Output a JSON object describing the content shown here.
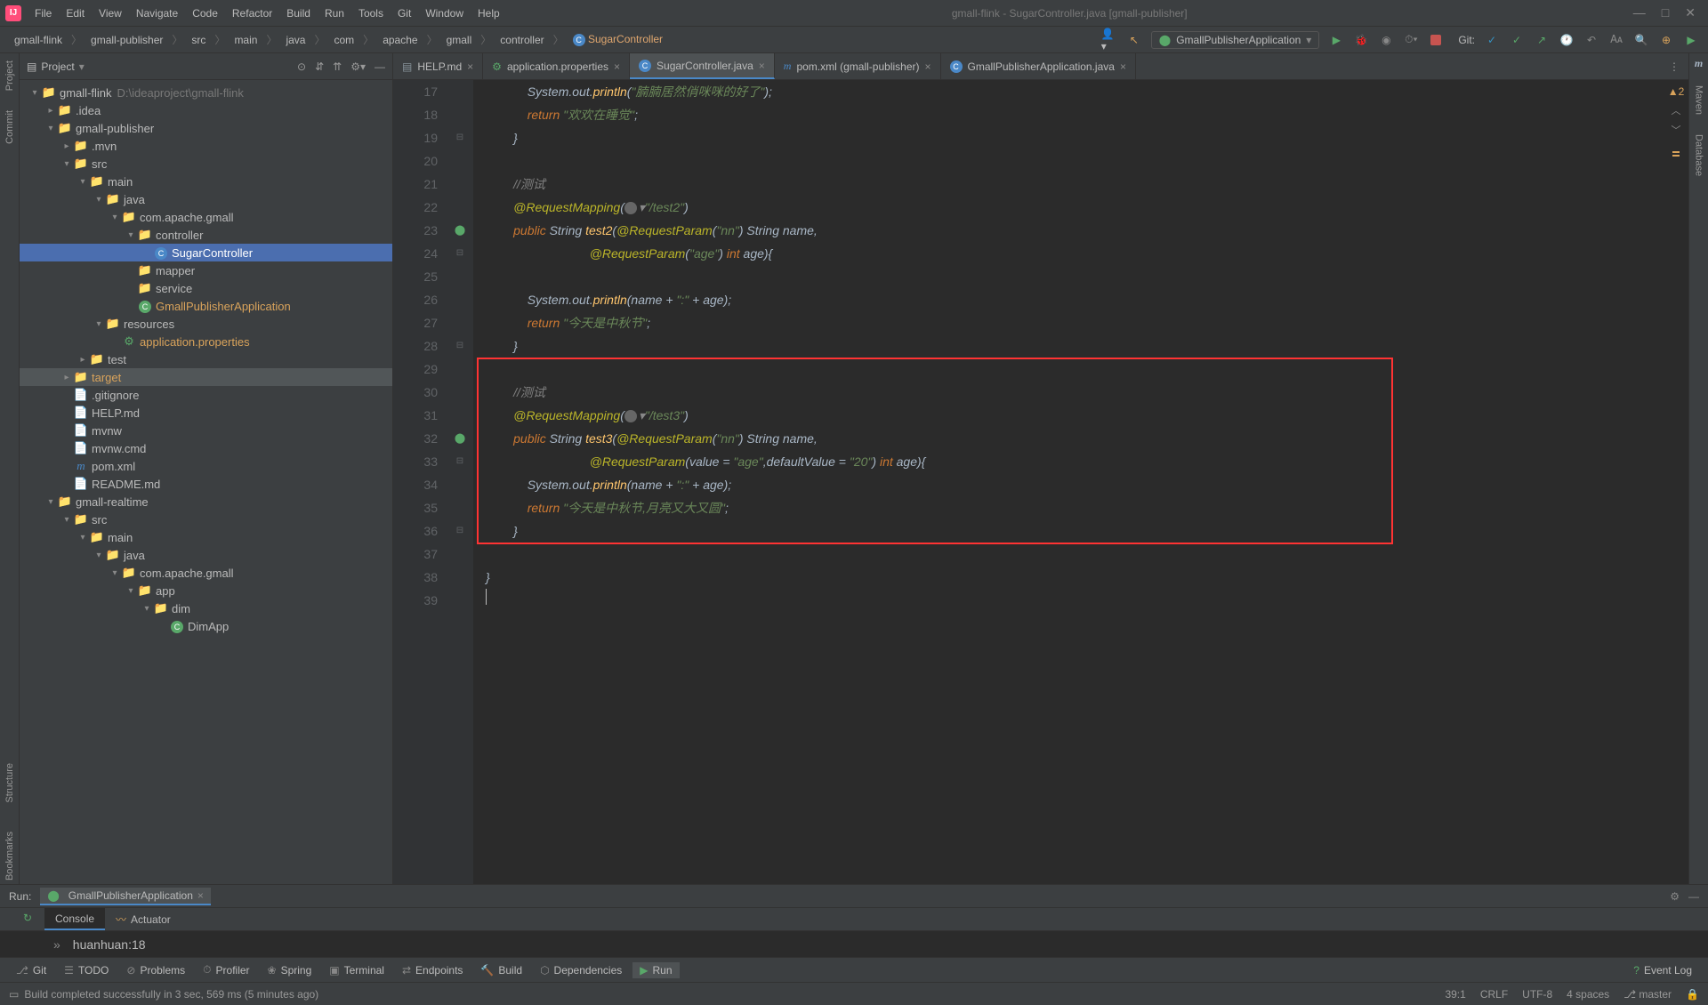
{
  "title": "gmall-flink - SugarController.java [gmall-publisher]",
  "menu": [
    "File",
    "Edit",
    "View",
    "Navigate",
    "Code",
    "Refactor",
    "Build",
    "Run",
    "Tools",
    "Git",
    "Window",
    "Help"
  ],
  "breadcrumbs": [
    "gmall-flink",
    "gmall-publisher",
    "src",
    "main",
    "java",
    "com",
    "apache",
    "gmall",
    "controller",
    "SugarController"
  ],
  "runConfig": "GmallPublisherApplication",
  "gitLabel": "Git:",
  "projectPanel": {
    "title": "Project"
  },
  "tree": [
    {
      "depth": 0,
      "arrow": "▾",
      "icon": "folder-blue",
      "label": "gmall-flink",
      "suffix": "D:\\ideaproject\\gmall-flink"
    },
    {
      "depth": 1,
      "arrow": "▸",
      "icon": "folder",
      "label": ".idea"
    },
    {
      "depth": 1,
      "arrow": "▾",
      "icon": "folder-blue",
      "label": "gmall-publisher"
    },
    {
      "depth": 2,
      "arrow": "▸",
      "icon": "folder",
      "label": ".mvn"
    },
    {
      "depth": 2,
      "arrow": "▾",
      "icon": "folder-blue",
      "label": "src"
    },
    {
      "depth": 3,
      "arrow": "▾",
      "icon": "folder-blue",
      "label": "main"
    },
    {
      "depth": 4,
      "arrow": "▾",
      "icon": "folder-blue",
      "label": "java"
    },
    {
      "depth": 5,
      "arrow": "▾",
      "icon": "folder",
      "label": "com.apache.gmall"
    },
    {
      "depth": 6,
      "arrow": "▾",
      "icon": "folder",
      "label": "controller"
    },
    {
      "depth": 7,
      "arrow": "",
      "icon": "class",
      "label": "SugarController",
      "selected": true
    },
    {
      "depth": 6,
      "arrow": "",
      "icon": "folder",
      "label": "mapper"
    },
    {
      "depth": 6,
      "arrow": "",
      "icon": "folder",
      "label": "service"
    },
    {
      "depth": 6,
      "arrow": "",
      "icon": "class-g",
      "label": "GmallPublisherApplication",
      "orange": true
    },
    {
      "depth": 4,
      "arrow": "▾",
      "icon": "folder",
      "label": "resources"
    },
    {
      "depth": 5,
      "arrow": "",
      "icon": "props",
      "label": "application.properties",
      "orange": true
    },
    {
      "depth": 3,
      "arrow": "▸",
      "icon": "folder-blue",
      "label": "test"
    },
    {
      "depth": 2,
      "arrow": "▸",
      "icon": "folder-orange",
      "label": "target",
      "highlight": true,
      "orange": true
    },
    {
      "depth": 2,
      "arrow": "",
      "icon": "file",
      "label": ".gitignore"
    },
    {
      "depth": 2,
      "arrow": "",
      "icon": "file",
      "label": "HELP.md"
    },
    {
      "depth": 2,
      "arrow": "",
      "icon": "file",
      "label": "mvnw"
    },
    {
      "depth": 2,
      "arrow": "",
      "icon": "file",
      "label": "mvnw.cmd"
    },
    {
      "depth": 2,
      "arrow": "",
      "icon": "pom",
      "label": "pom.xml"
    },
    {
      "depth": 2,
      "arrow": "",
      "icon": "file",
      "label": "README.md"
    },
    {
      "depth": 1,
      "arrow": "▾",
      "icon": "folder-blue",
      "label": "gmall-realtime"
    },
    {
      "depth": 2,
      "arrow": "▾",
      "icon": "folder-blue",
      "label": "src"
    },
    {
      "depth": 3,
      "arrow": "▾",
      "icon": "folder-blue",
      "label": "main"
    },
    {
      "depth": 4,
      "arrow": "▾",
      "icon": "folder-blue",
      "label": "java"
    },
    {
      "depth": 5,
      "arrow": "▾",
      "icon": "folder",
      "label": "com.apache.gmall"
    },
    {
      "depth": 6,
      "arrow": "▾",
      "icon": "folder",
      "label": "app"
    },
    {
      "depth": 7,
      "arrow": "▾",
      "icon": "folder",
      "label": "dim"
    },
    {
      "depth": 8,
      "arrow": "",
      "icon": "class-g",
      "label": "DimApp"
    }
  ],
  "tabs": [
    {
      "icon": "md",
      "label": "HELP.md"
    },
    {
      "icon": "props",
      "label": "application.properties"
    },
    {
      "icon": "class",
      "label": "SugarController.java",
      "active": true
    },
    {
      "icon": "pom",
      "label": "pom.xml (gmall-publisher)"
    },
    {
      "icon": "class",
      "label": "GmallPublisherApplication.java"
    }
  ],
  "lineStart": 17,
  "lineEnd": 39,
  "code": {
    "l17": {
      "t1": "System.",
      "out": "out",
      "t2": ".",
      "println": "println",
      "t3": "(",
      "s": "\"腩腩居然俏咪咪的好了\"",
      "t4": ");"
    },
    "l18": {
      "kw": "return ",
      "s": "\"欢欢在睡觉\"",
      "t": ";"
    },
    "l19": "        }",
    "l20": "",
    "l21": {
      "cmt": "//测试"
    },
    "l22": {
      "ann": "@RequestMapping",
      "t1": "(",
      "s": "\"/test2\"",
      "t2": ")"
    },
    "l23": {
      "kw1": "public ",
      "t1": "String ",
      "m": "test2",
      "t2": "(",
      "ann": "@RequestParam",
      "t3": "(",
      "s": "\"nn\"",
      "t4": ") String name,"
    },
    "l24": {
      "ann": "@RequestParam",
      "t1": "(",
      "s": "\"age\"",
      "t2": ") ",
      "kw": "int ",
      "t3": "age){"
    },
    "l25": "",
    "l26": {
      "t1": "System.",
      "out": "out",
      "t2": ".",
      "println": "println",
      "t3": "(name + ",
      "s": "\":\"",
      "t4": " + age);"
    },
    "l27": {
      "kw": "return ",
      "s": "\"今天是中秋节\"",
      "t": ";"
    },
    "l28": "        }",
    "l29": "",
    "l30": {
      "cmt": "//测试"
    },
    "l31": {
      "ann": "@RequestMapping",
      "t1": "(",
      "s": "\"/test3\"",
      "t2": ")"
    },
    "l32": {
      "kw1": "public ",
      "t1": "String ",
      "m": "test3",
      "t2": "(",
      "ann": "@RequestParam",
      "t3": "(",
      "s": "\"nn\"",
      "t4": ") String name,"
    },
    "l33": {
      "ann": "@RequestParam",
      "t1": "(value = ",
      "s1": "\"age\"",
      "t2": ",defaultValue = ",
      "s2": "\"20\"",
      "t3": ") ",
      "kw": "int ",
      "t4": "age){"
    },
    "l34": {
      "t1": "System.",
      "out": "out",
      "t2": ".",
      "println": "println",
      "t3": "(name + ",
      "s": "\":\"",
      "t4": " + age);"
    },
    "l35": {
      "kw": "return ",
      "s": "\"今天是中秋节,月亮又大又圆\"",
      "t": ";"
    },
    "l36": "        }",
    "l37": "",
    "l38": "}",
    "l39": ""
  },
  "warnCount": "2",
  "runPanel": {
    "label": "Run:",
    "config": "GmallPublisherApplication",
    "tab1": "Console",
    "tab2": "Actuator",
    "output": "huanhuan:18"
  },
  "bottomTools": [
    "Git",
    "TODO",
    "Problems",
    "Profiler",
    "Spring",
    "Terminal",
    "Endpoints",
    "Build",
    "Dependencies",
    "Run"
  ],
  "bottomToolActive": "Run",
  "eventLog": "Event Log",
  "statusMsg": "Build completed successfully in 3 sec, 569 ms (5 minutes ago)",
  "status": {
    "pos": "39:1",
    "crlf": "CRLF",
    "enc": "UTF-8",
    "indent": "4 spaces",
    "branch": "master"
  },
  "leftStrip": [
    "Project",
    "Commit",
    "Structure",
    "Bookmarks"
  ],
  "rightStrip": [
    "Maven",
    "Database"
  ]
}
